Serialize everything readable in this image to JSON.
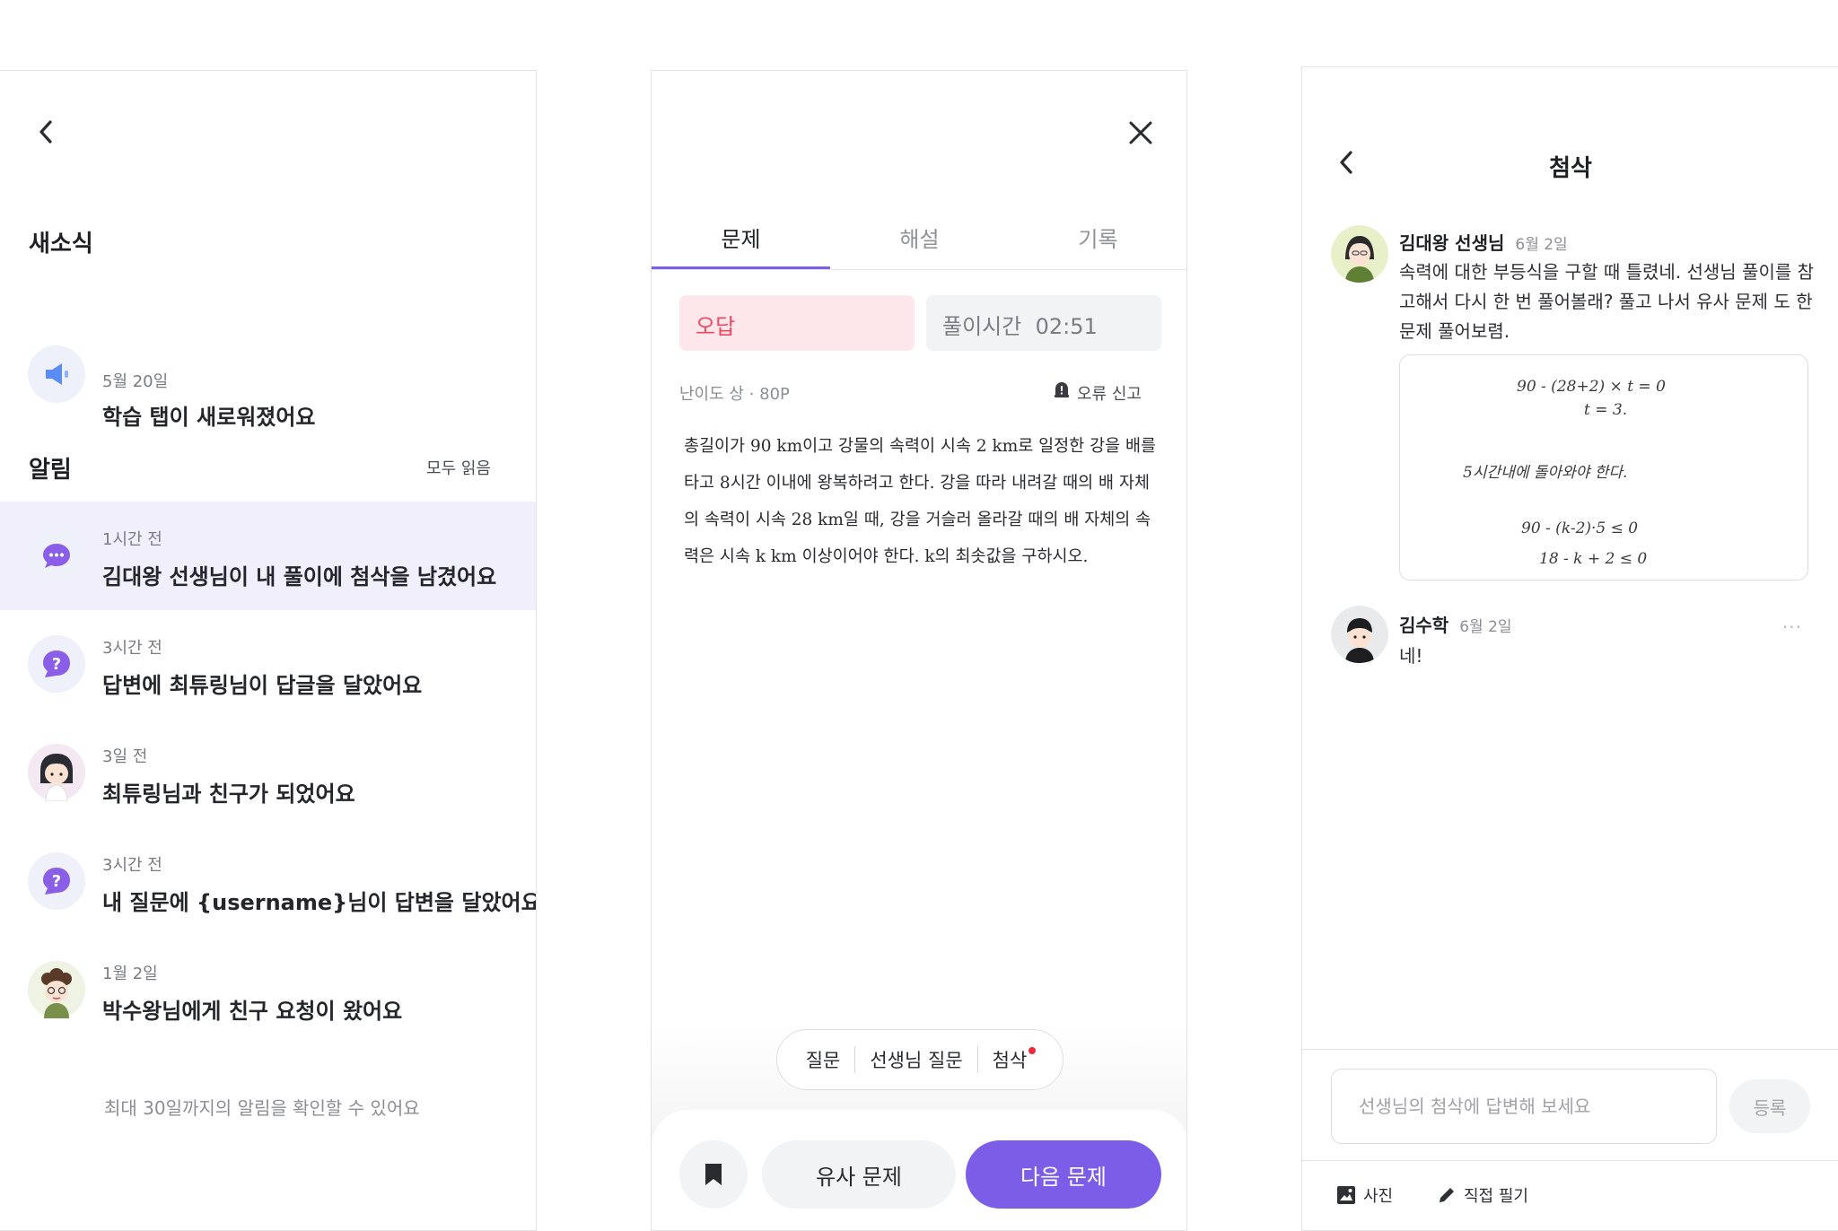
{
  "news_screen": {
    "section_title": "새소식",
    "news_item": {
      "date": "5월 20일",
      "title": "학습 탭이 새로워졌어요"
    },
    "alerts_title": "알림",
    "read_all": "모두 읽음",
    "notifications": [
      {
        "time": "1시간 전",
        "title": "김대왕 선생님이 내 풀이에 첨삭을 남겼어요",
        "icon": "chat-bubble-icon"
      },
      {
        "time": "3시간 전",
        "title": "답변에 최튜링님이 답글을 달았어요",
        "icon": "question-icon"
      },
      {
        "time": "3일 전",
        "title": "최튜링님과 친구가 되었어요",
        "icon": "avatar"
      },
      {
        "time": "3시간 전",
        "title": "내 질문에 {username}님이 답변을 달았어요",
        "icon": "question-icon"
      },
      {
        "time": "1월 2일",
        "title": "박수왕님에게 친구 요청이 왔어요",
        "icon": "avatar"
      }
    ],
    "footer_note": "최대 30일까지의 알림을 확인할 수 있어요"
  },
  "problem_screen": {
    "tabs": [
      "문제",
      "해설",
      "기록"
    ],
    "result": "오답",
    "solve_time_label": "풀이시간",
    "solve_time": "02:51",
    "meta": "난이도 상 · 80P",
    "report_label": "오류 신고",
    "problem_text": "총길이가 90 km이고 강물의 속력이 시속 2 km로 일정한 강을 배를 타고 8시간 이내에 왕복하려고 한다. 강을 따라 내려갈 때의 배 자체의 속력이 시속 28 km일 때, 강을 거슬러 올라갈 때의 배 자체의 속력은 시속 k km 이상이어야 한다. k의 최솟값을 구하시오.",
    "pill_items": [
      "질문",
      "선생님 질문",
      "첨삭"
    ],
    "similar_button": "유사 문제",
    "next_button": "다음 문제",
    "colors": {
      "accent": "#7b5de8",
      "wrong": "#f0485f",
      "wrong_bg": "#fde7ea"
    }
  },
  "review_screen": {
    "title": "첨삭",
    "comments": [
      {
        "name": "김대왕 선생님",
        "date": "6월 2일",
        "text": "속력에 대한 부등식을 구할 때 틀렸네. 선생님 풀이를 참고해서 다시 한 번 풀어볼래? 풀고 나서 유사 문제 도 한 문제 풀어보렴."
      },
      {
        "name": "김수학",
        "date": "6월 2일",
        "text": "네!"
      }
    ],
    "sketch_lines": [
      "90 - (28+2) × t = 0",
      "t = 3.",
      "5시간내에 돌아와야 한다.",
      "90 - (k-2)·5 ≤ 0",
      "18 - k + 2 ≤ 0"
    ],
    "more": "···",
    "reply_placeholder": "선생님의 첨삭에 답변해 보세요",
    "submit_button": "등록",
    "tools": [
      {
        "label": "사진",
        "icon": "photo-icon"
      },
      {
        "label": "직접 필기",
        "icon": "pencil-icon"
      }
    ]
  }
}
